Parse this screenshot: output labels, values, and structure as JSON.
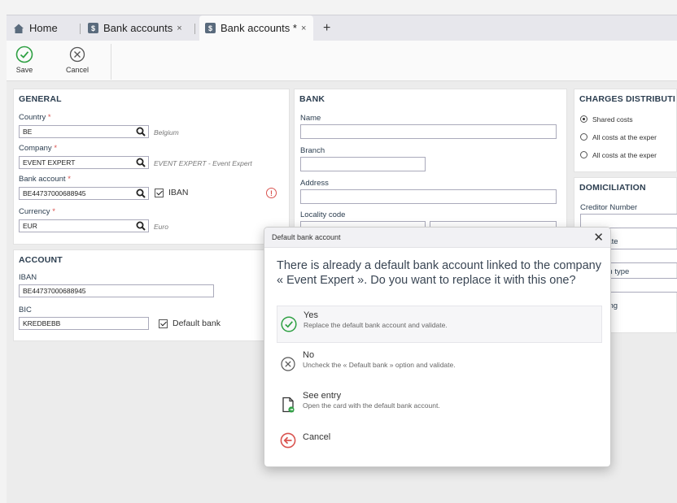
{
  "tabs": {
    "home": "Home",
    "tab1": "Bank accounts",
    "tab2": "Bank accounts *",
    "close": "×",
    "add": "+"
  },
  "toolbar": {
    "save": "Save",
    "cancel": "Cancel"
  },
  "general": {
    "title": "GENERAL",
    "country_label": "Country",
    "country_value": "BE",
    "country_hint": "Belgium",
    "company_label": "Company",
    "company_value": "EVENT EXPERT",
    "company_hint": "EVENT EXPERT - Event Expert",
    "bank_label": "Bank account",
    "bank_value": "BE44737000688945",
    "iban_check": "IBAN",
    "currency_label": "Currency",
    "currency_value": "EUR",
    "currency_hint": "Euro",
    "required_mark": "*"
  },
  "account": {
    "title": "ACCOUNT",
    "iban_label": "IBAN",
    "iban_value": "BE44737000688945",
    "bic_label": "BIC",
    "bic_value": "KREDBEBB",
    "default_bank": "Default bank"
  },
  "bank": {
    "title": "BANK",
    "name_label": "Name",
    "branch_label": "Branch",
    "address_label": "Address",
    "locality_label": "Locality code"
  },
  "charges": {
    "title": "CHARGES DISTRIBUTI",
    "opt1": "Shared costs",
    "opt2": "All costs at the exper",
    "opt3": "All costs at the exper"
  },
  "domiciliation": {
    "title": "DOMICILIATION",
    "creditor": "Creditor Number",
    "date": "re date",
    "type": "iation type",
    "recurring": "curring"
  },
  "modal": {
    "title": "Default bank account",
    "close": "✕",
    "question": "There is already a default bank account linked to the company « Event Expert ». Do you want to replace it with this one?",
    "options": [
      {
        "title": "Yes",
        "sub": "Replace the default bank account and validate."
      },
      {
        "title": "No",
        "sub": "Uncheck the « Default bank » option and validate."
      },
      {
        "title": "See entry",
        "sub": "Open the card with the default bank account."
      },
      {
        "title": "Cancel",
        "sub": ""
      }
    ]
  }
}
